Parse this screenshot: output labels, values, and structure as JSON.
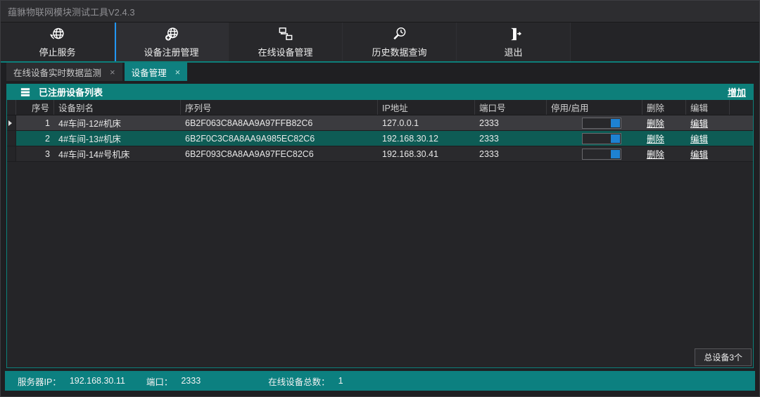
{
  "window": {
    "title": "蕴貅物联网模块测试工具V2.4.3"
  },
  "toolbar": {
    "buttons": [
      {
        "label": "停止服务",
        "icon": "globe-stop-icon"
      },
      {
        "label": "设备注册管理",
        "icon": "globe-add-icon"
      },
      {
        "label": "在线设备管理",
        "icon": "network-devices-icon"
      },
      {
        "label": "历史数据查询",
        "icon": "search-history-icon"
      },
      {
        "label": "退出",
        "icon": "exit-door-icon"
      }
    ]
  },
  "tabs": [
    {
      "label": "在线设备实时数据监测",
      "close_glyph": "×",
      "active": false
    },
    {
      "label": "设备管理",
      "close_glyph": "×",
      "active": true
    }
  ],
  "panel": {
    "title": "已注册设备列表",
    "add_link": "增加",
    "total_badge": "总设备3个"
  },
  "table": {
    "columns": [
      "序号",
      "设备别名",
      "序列号",
      "IP地址",
      "端口号",
      "停用/启用",
      "删除",
      "编辑"
    ],
    "row_action_labels": {
      "delete": "删除",
      "edit": "编辑"
    },
    "rows": [
      {
        "index": "1",
        "alias": "4#车间-12#机床",
        "serial": "6B2F063C8A8AA9A97FFB82C6",
        "ip": "127.0.0.1",
        "port": "2333",
        "enabled": true,
        "current": true,
        "selected": false
      },
      {
        "index": "2",
        "alias": "4#车间-13#机床",
        "serial": "6B2F0C3C8A8AA9A985EC82C6",
        "ip": "192.168.30.12",
        "port": "2333",
        "enabled": true,
        "current": false,
        "selected": true
      },
      {
        "index": "3",
        "alias": "4#车间-14#号机床",
        "serial": "6B2F093C8A8AA9A97FEC82C6",
        "ip": "192.168.30.41",
        "port": "2333",
        "enabled": true,
        "current": false,
        "selected": false
      }
    ]
  },
  "statusbar": {
    "server_ip_label": "服务器IP：",
    "server_ip": "192.168.30.11",
    "port_label": "端口：",
    "port": "2333",
    "online_total_label": "在线设备总数：",
    "online_total": "1"
  },
  "colors": {
    "accent_teal": "#0d7f7a",
    "selected_row_teal": "#0e5c55",
    "toggle_on_blue": "#1e82d2",
    "active_button_indicator_blue": "#2196f3"
  }
}
